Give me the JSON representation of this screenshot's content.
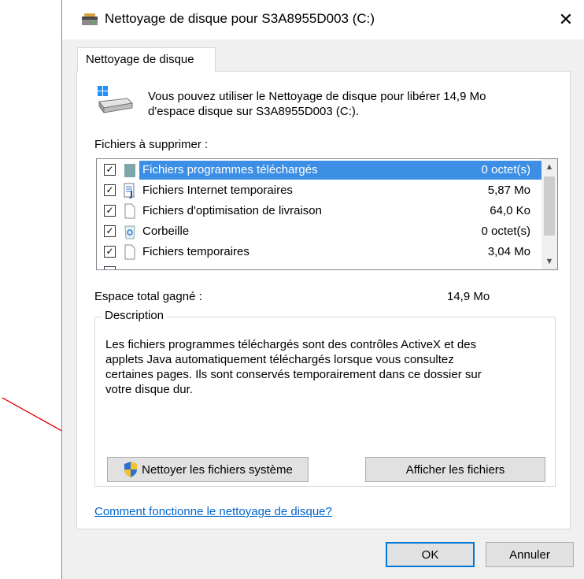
{
  "window": {
    "title": "Nettoyage de disque pour S3A8955D003 (C:)",
    "close_glyph": "✕"
  },
  "tab": {
    "label": "Nettoyage de disque"
  },
  "intro": {
    "text_line1": "Vous pouvez utiliser le Nettoyage de disque pour libérer 14,9 Mo",
    "text_line2": "d'espace disque sur S3A8955D003 (C:)."
  },
  "files": {
    "label": "Fichiers à supprimer :",
    "items": [
      {
        "name": "Fichiers programmes téléchargés",
        "size": "0 octet(s)",
        "checked": true,
        "selected": true,
        "icon": "folder-icon"
      },
      {
        "name": "Fichiers Internet temporaires",
        "size": "5,87 Mo",
        "checked": true,
        "selected": false,
        "icon": "internet-file-icon"
      },
      {
        "name": "Fichiers d'optimisation de livraison",
        "size": "64,0 Ko",
        "checked": true,
        "selected": false,
        "icon": "file-icon"
      },
      {
        "name": "Corbeille",
        "size": "0 octet(s)",
        "checked": true,
        "selected": false,
        "icon": "recycle-bin-icon"
      },
      {
        "name": "Fichiers temporaires",
        "size": "3,04 Mo",
        "checked": true,
        "selected": false,
        "icon": "file-icon"
      }
    ],
    "check_glyph": "✓",
    "scroll_up": "▲",
    "scroll_down": "▼"
  },
  "total": {
    "label": "Espace total gagné :",
    "value": "14,9 Mo"
  },
  "description": {
    "legend": "Description",
    "line1": "Les fichiers programmes téléchargés sont des contrôles ActiveX et des",
    "line2": "applets Java automatiquement téléchargés lorsque vous consultez",
    "line3": "certaines pages. Ils sont conservés temporairement dans ce dossier sur",
    "line4": "votre disque dur."
  },
  "buttons": {
    "clean_system": "Nettoyer les fichiers système",
    "show_files": "Afficher les fichiers",
    "ok": "OK",
    "cancel": "Annuler"
  },
  "help_link": "Comment fonctionne le nettoyage de disque?",
  "colors": {
    "selection": "#3d8ee5",
    "link": "#0066cc",
    "annotation_arrow": "#e00000",
    "default_button_border": "#0078d7"
  }
}
